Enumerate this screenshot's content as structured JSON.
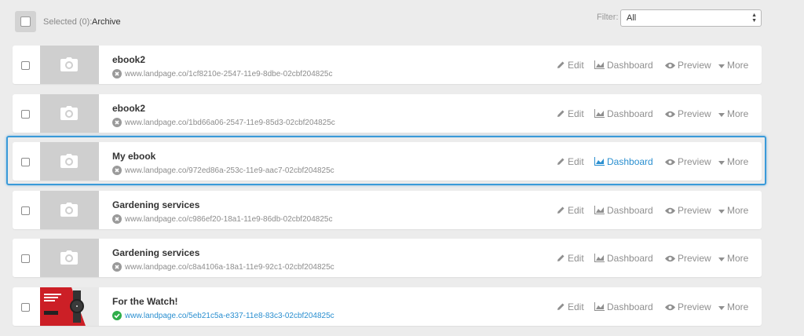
{
  "toolbar": {
    "selected_label": "Selected (0):",
    "archive_label": "Archive",
    "filter_label": "Filter:",
    "filter_value": "All"
  },
  "actions": {
    "edit": "Edit",
    "dashboard": "Dashboard",
    "preview": "Preview",
    "more": "More"
  },
  "colors": {
    "accent": "#2a8fd0",
    "highlight_border": "#3a9ad9",
    "published": "#2fae4a",
    "unpublished": "#9a9a9a"
  },
  "pages": [
    {
      "name": "ebook2",
      "url": "www.landpage.co/1cf8210e-2547-11e9-8dbe-02cbf204825c",
      "status": "unpublished",
      "thumbnail": "camera-icon"
    },
    {
      "name": "ebook2",
      "url": "www.landpage.co/1bd66a06-2547-11e9-85d3-02cbf204825c",
      "status": "unpublished",
      "thumbnail": "camera-icon"
    },
    {
      "name": "My ebook",
      "url": "www.landpage.co/972ed86a-253c-11e9-aac7-02cbf204825c",
      "status": "unpublished",
      "thumbnail": "camera-icon",
      "highlighted": true
    },
    {
      "name": "Gardening services",
      "url": "www.landpage.co/c986ef20-18a1-11e9-86db-02cbf204825c",
      "status": "unpublished",
      "thumbnail": "camera-icon"
    },
    {
      "name": "Gardening services",
      "url": "www.landpage.co/c8a4106a-18a1-11e9-92c1-02cbf204825c",
      "status": "unpublished",
      "thumbnail": "camera-icon"
    },
    {
      "name": "For the Watch!",
      "url": "www.landpage.co/5eb21c5a-e337-11e8-83c3-02cbf204825c",
      "status": "published",
      "thumbnail": "watch-ad-image"
    }
  ]
}
